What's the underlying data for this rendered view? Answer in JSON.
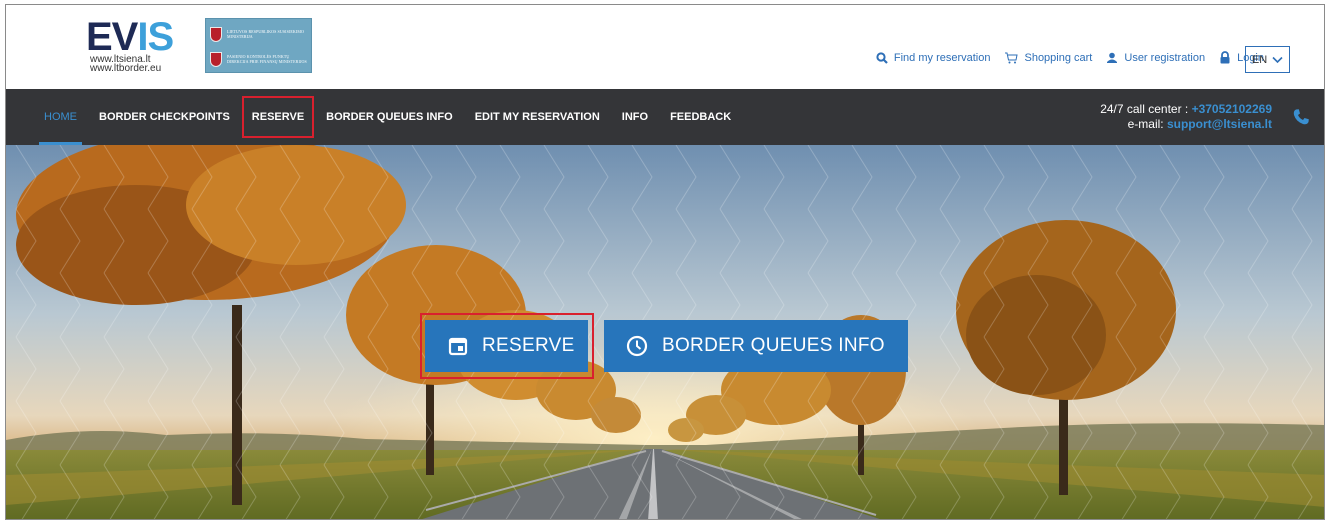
{
  "logo": {
    "brand_part1": "EV",
    "brand_part2": "IS",
    "url1": "www.ltsiena.lt",
    "url2": "www.ltborder.eu",
    "ministry_line1": "LIETUVOS RESPUBLIKOS SUSISIEKIMO MINISTERIJA",
    "ministry_line2": "PASIENIO KONTROLĖS PUNKTŲ DIREKCIJA PRIE FINANSŲ MINISTERIJOS"
  },
  "toplinks": {
    "find": "Find my reservation",
    "cart": "Shopping cart",
    "register": "User registration",
    "login": "Login",
    "lang": "EN"
  },
  "nav": {
    "items": [
      "HOME",
      "BORDER CHECKPOINTS",
      "RESERVE",
      "BORDER QUEUES INFO",
      "EDIT MY RESERVATION",
      "INFO",
      "FEEDBACK"
    ]
  },
  "contact": {
    "call_label": "24/7 call center : ",
    "phone": "+37052102269",
    "email_label": "e-mail: ",
    "email": "support@ltsiena.lt"
  },
  "hero": {
    "reserve_label": "RESERVE",
    "queues_label": "BORDER QUEUES INFO"
  },
  "colors": {
    "accent": "#2775bb",
    "nav_bg": "#343538",
    "highlight": "#d9202e"
  }
}
